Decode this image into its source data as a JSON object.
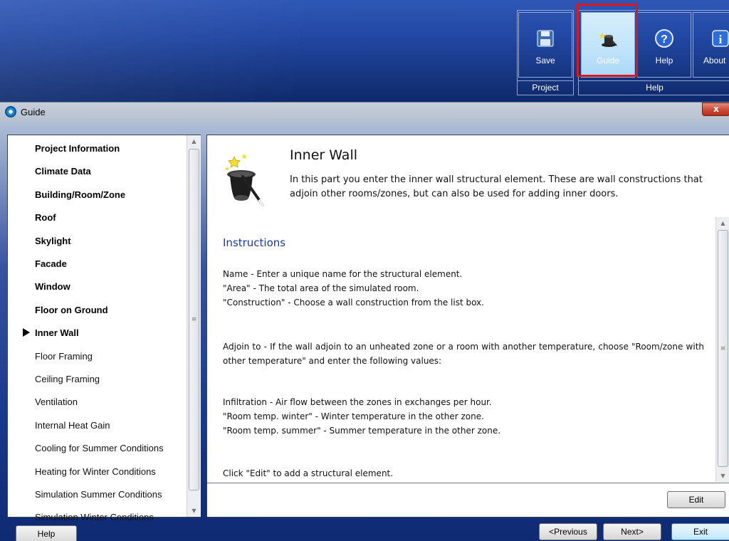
{
  "ribbon": {
    "buttons": [
      {
        "label": "Save",
        "icon": "floppy-disk-icon"
      },
      {
        "label": "Guide",
        "icon": "magic-hat-icon"
      },
      {
        "label": "Help",
        "icon": "question-icon"
      },
      {
        "label": "About",
        "icon": "info-icon"
      }
    ],
    "groups": {
      "project": "Project",
      "help": "Help"
    }
  },
  "window": {
    "title": "Guide",
    "close_label": "x"
  },
  "nav": {
    "items": [
      {
        "label": "Project Information",
        "bold": true
      },
      {
        "label": "Climate Data",
        "bold": true
      },
      {
        "label": "Building/Room/Zone",
        "bold": true
      },
      {
        "label": "Roof",
        "bold": true
      },
      {
        "label": "Skylight",
        "bold": true
      },
      {
        "label": "Facade",
        "bold": true
      },
      {
        "label": "Window",
        "bold": true
      },
      {
        "label": "Floor on Ground",
        "bold": true
      },
      {
        "label": "Inner Wall",
        "bold": true,
        "current": true
      },
      {
        "label": "Floor Framing",
        "bold": false
      },
      {
        "label": "Ceiling Framing",
        "bold": false
      },
      {
        "label": "Ventilation",
        "bold": false
      },
      {
        "label": "Internal Heat Gain",
        "bold": false
      },
      {
        "label": "Cooling for Summer Conditions",
        "bold": false
      },
      {
        "label": "Heating for Winter Conditions",
        "bold": false
      },
      {
        "label": "Simulation Summer Conditions",
        "bold": false
      },
      {
        "label": "Simulation Winter Conditions",
        "bold": false
      }
    ]
  },
  "content": {
    "title": "Inner Wall",
    "intro": "In this part you enter the inner wall structural element. These are wall constructions that adjoin other rooms/zones, but can also be used for adding inner doors.",
    "instructions_heading": "Instructions",
    "paragraphs": [
      [
        "Name - Enter a unique name for the structural element.",
        "\"Area\" - The total area of the simulated room.",
        "\"Construction\" - Choose a wall construction from the list box."
      ],
      [
        "Adjoin to - If the wall adjoin to an unheated zone or a room with another temperature, choose \"Room/zone with other temperature\" and enter the following values:"
      ],
      [
        "Infiltration - Air flow between the zones in exchanges per hour.",
        "\"Room temp. winter\" - Winter temperature in the other zone.",
        "\"Room temp. summer\" - Summer temperature in the other zone."
      ],
      [
        "Click \"Edit\" to add a structural element."
      ]
    ],
    "edit_label": "Edit"
  },
  "footer": {
    "help_label": "Help",
    "previous_label": "<Previous",
    "next_label": "Next>",
    "exit_label": "Exit"
  },
  "colors": {
    "highlight": "#e0141b",
    "heading_blue": "#1f3a94"
  }
}
